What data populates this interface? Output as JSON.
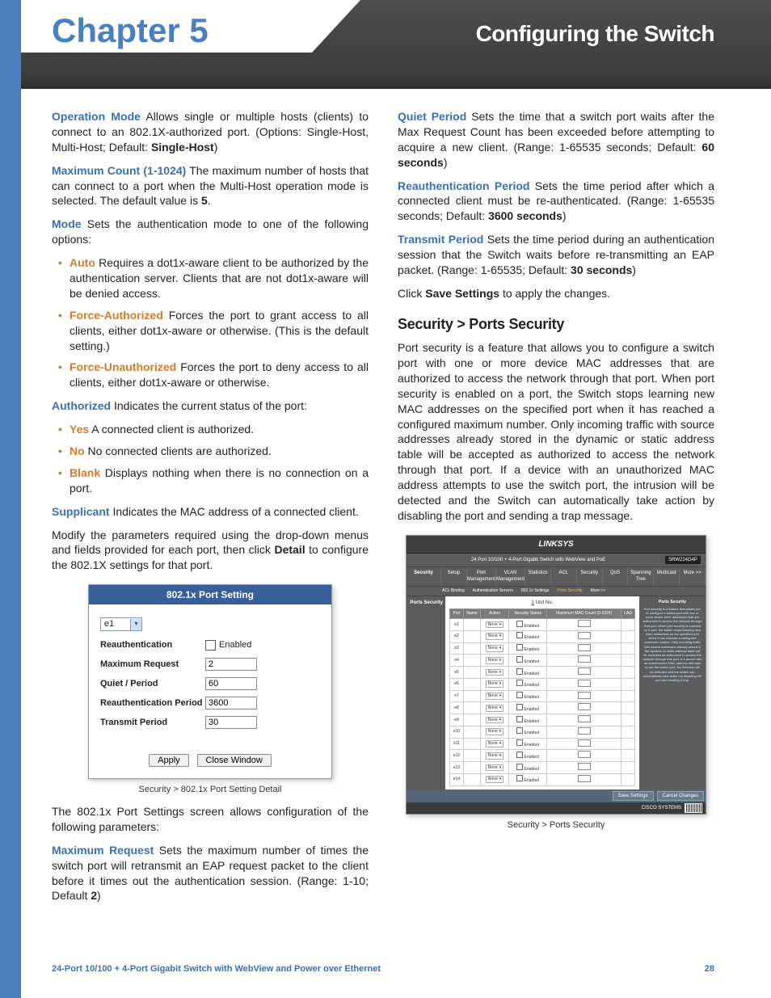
{
  "header": {
    "chapter": "Chapter 5",
    "section": "Configuring the Switch"
  },
  "left": {
    "opmode_label": "Operation Mode",
    "opmode_text": "  Allows single or multiple hosts (clients) to connect to an 802.1X-authorized port. (Options: Single-Host, Multi-Host; Default: ",
    "opmode_default": "Single-Host",
    "opmode_close": ")",
    "maxcount_label": "Maximum Count (1-1024)",
    "maxcount_text": " The maximum number of hosts that can connect to a port when the Multi-Host operation mode is selected. The default value is ",
    "maxcount_default": "5",
    "maxcount_close": ".",
    "mode_label": "Mode",
    "mode_text": " Sets the authentication mode to one of the following options:",
    "mode_auto_label": "Auto",
    "mode_auto_text": "  Requires a dot1x-aware client to be authorized by the authentication server. Clients that are not dot1x-aware will be denied access.",
    "mode_fa_label": "Force-Authorized",
    "mode_fa_text": "  Forces the port to grant access to all clients, either dot1x-aware or otherwise. (This is the default setting.)",
    "mode_fu_label": "Force-Unauthorized",
    "mode_fu_text": "  Forces the port to deny access to all clients, either dot1x-aware or otherwise.",
    "auth_label": "Authorized",
    "auth_text": "  Indicates the current status of the port:",
    "yes_label": "Yes",
    "yes_text": "  A connected client is authorized.",
    "no_label": "No",
    "no_text": "  No connected clients are authorized.",
    "blank_label": "Blank",
    "blank_text": "  Displays nothing when there is no connection on a port.",
    "supp_label": "Supplicant",
    "supp_text": "  Indicates the MAC address of a connected client.",
    "modify_text_1": "Modify the parameters required using the drop-down menus and fields provided for each port, then click ",
    "modify_detail": "Detail",
    "modify_text_2": " to configure the 802.1X settings for that port.",
    "fig1_caption": "Security > 802.1x Port Setting Detail",
    "after_fig1": "The 802.1x Port Settings screen allows configuration of the following parameters:",
    "maxreq_label": "Maximum Request",
    "maxreq_text": "  Sets the maximum number of times the switch port will retransmit an EAP request packet to the client before it times out the authentication session. (Range: 1-10; Default ",
    "maxreq_default": "2",
    "maxreq_close": ")"
  },
  "right": {
    "quiet_label": "Quiet Period",
    "quiet_text": " Sets the time that a switch port waits after the Max Request Count has been exceeded before attempting to acquire a new client. (Range: 1-65535 seconds; Default: ",
    "quiet_default": "60 seconds",
    "quiet_close": ")",
    "reauth_label": "Reauthentication Period",
    "reauth_text": " Sets the time period after which a connected client must be re-authenticated. (Range: 1-65535 seconds; Default: ",
    "reauth_default": "3600 seconds",
    "reauth_close": ")",
    "tx_label": "Transmit Period",
    "tx_text": " Sets the time period during an authentication session that the Switch waits before re-transmitting an EAP packet. (Range: 1-65535; Default: ",
    "tx_default": "30 seconds",
    "tx_close": ")",
    "save_pre": "Click ",
    "save_btn": "Save Settings",
    "save_post": " to apply the changes.",
    "subheading": "Security > Ports Security",
    "ports_para": "Port security is a feature that allows you to configure a switch port with one or more device MAC addresses that are authorized to access the network through that port. When port security is enabled on a port, the Switch stops learning new MAC addresses on the specified port when it has reached a configured maximum number. Only incoming traffic with source addresses already stored in the dynamic or static address table will be accepted as authorized to access the network through that port. If a device with an unauthorized MAC address attempts to use the switch port, the intrusion will be detected and the Switch can automatically take action by disabling the port and sending a trap message.",
    "fig2_caption": "Security > Ports Security"
  },
  "fig8021x": {
    "title": "802.1x Port Setting",
    "port": "e1",
    "reauth_label": "Reauthentication",
    "reauth_enabled": "Enabled",
    "maxreq_label": "Maximum Request",
    "maxreq_val": "2",
    "quiet_label": "Quiet / Period",
    "quiet_val": "60",
    "reauthp_label": "Reauthentication Period",
    "reauthp_val": "3600",
    "tx_label": "Transmit Period",
    "tx_val": "30",
    "apply": "Apply",
    "close": "Close Window"
  },
  "figports": {
    "brand": "LINKSYS",
    "desc": "24 Port 10/100 + 4-Port Gigabit Switch with WebView and PoE",
    "model": "SRW224G4P",
    "side_label": "Security",
    "tabs": [
      "Setup",
      "Port Management",
      "VLAN Management",
      "Statistics",
      "ACL",
      "Security",
      "QoS",
      "Spanning Tree",
      "Multicast",
      "More >>"
    ],
    "subtabs": [
      "ACL Binding",
      "Authentication Servers",
      "802.1x Settings",
      "Ports Security",
      "More >>"
    ],
    "body_side": "Ports Security",
    "unit": "Unit No.",
    "unit_val": "1",
    "headers": [
      "Port",
      "Name",
      "Action",
      "Security Status",
      "Maximum MAC Count (0-1024)",
      "LAG"
    ],
    "rows": [
      {
        "port": "e1",
        "action": "None"
      },
      {
        "port": "e2",
        "action": "None"
      },
      {
        "port": "e3",
        "action": "None"
      },
      {
        "port": "e4",
        "action": "None"
      },
      {
        "port": "e5",
        "action": "None"
      },
      {
        "port": "e6",
        "action": "None"
      },
      {
        "port": "e7",
        "action": "None"
      },
      {
        "port": "e8",
        "action": "None"
      },
      {
        "port": "e9",
        "action": "None"
      },
      {
        "port": "e10",
        "action": "None"
      },
      {
        "port": "e11",
        "action": "None"
      },
      {
        "port": "e12",
        "action": "None"
      },
      {
        "port": "e13",
        "action": "None"
      },
      {
        "port": "e14",
        "action": "None"
      }
    ],
    "enabled": "Enabled",
    "help_title": "Ports Security",
    "help_body": "Port security is a feature that allows you to configure a switch port with one or more device MAC addresses that are authorized to access the network through that port. When port security is enabled on a port, the switch stops learning new MAC addresses on the specified port when it has reached a configured maximum number. Only incoming traffic with source addresses already stored in the dynamic or static address table will be accepted as authorized to access the network through that port. If a device with an unauthorized MAC address attempts to use the switch port, the intrusion will be detected and the switch can automatically take action by disabling the port and sending a trap.",
    "save": "Save Settings",
    "cancel": "Cancel Changes",
    "cisco": "CISCO SYSTEMS"
  },
  "footer": {
    "left": "24-Port 10/100 + 4-Port Gigabit Switch with WebView and Power over Ethernet",
    "right": "28"
  }
}
